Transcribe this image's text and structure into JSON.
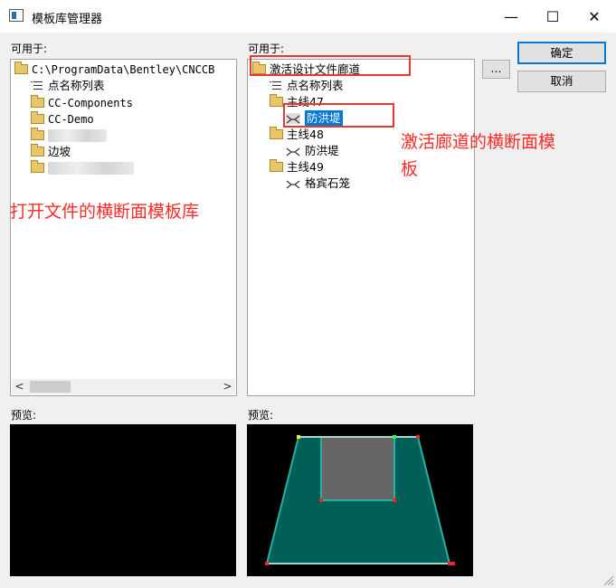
{
  "window": {
    "title": "模板库管理器",
    "controls": {
      "minimize": "—",
      "maximize": "☐",
      "close": "✕"
    }
  },
  "left": {
    "available_label": "可用于:",
    "root_path": "C:\\ProgramData\\Bentley\\CNCCB",
    "items": [
      "点名称列表",
      "CC-Components",
      "CC-Demo",
      "边坡"
    ],
    "scroll_left": "<",
    "scroll_right": ">"
  },
  "right": {
    "available_label": "可用于:",
    "root": "激活设计文件廊道",
    "list_item": "点名称列表",
    "groups": [
      {
        "name": "主线47",
        "child": "防洪堤"
      },
      {
        "name": "主线48",
        "child": "防洪堤"
      },
      {
        "name": "主线49",
        "child": "格宾石笼"
      }
    ],
    "browse_button": "..."
  },
  "buttons": {
    "ok": "确定",
    "cancel": "取消"
  },
  "preview": {
    "left_label": "预览:",
    "right_label": "预览:"
  },
  "annotations": {
    "left_note": "打开文件的横断面模板库",
    "right_note_line1": "激活廊道的横断面模",
    "right_note_line2": "板"
  },
  "colors": {
    "accent": "#0078d7",
    "annotation": "#ff2a2a",
    "preview_fill": "#006058",
    "preview_edge": "#20b2aa",
    "preview_inner": "#666666"
  }
}
